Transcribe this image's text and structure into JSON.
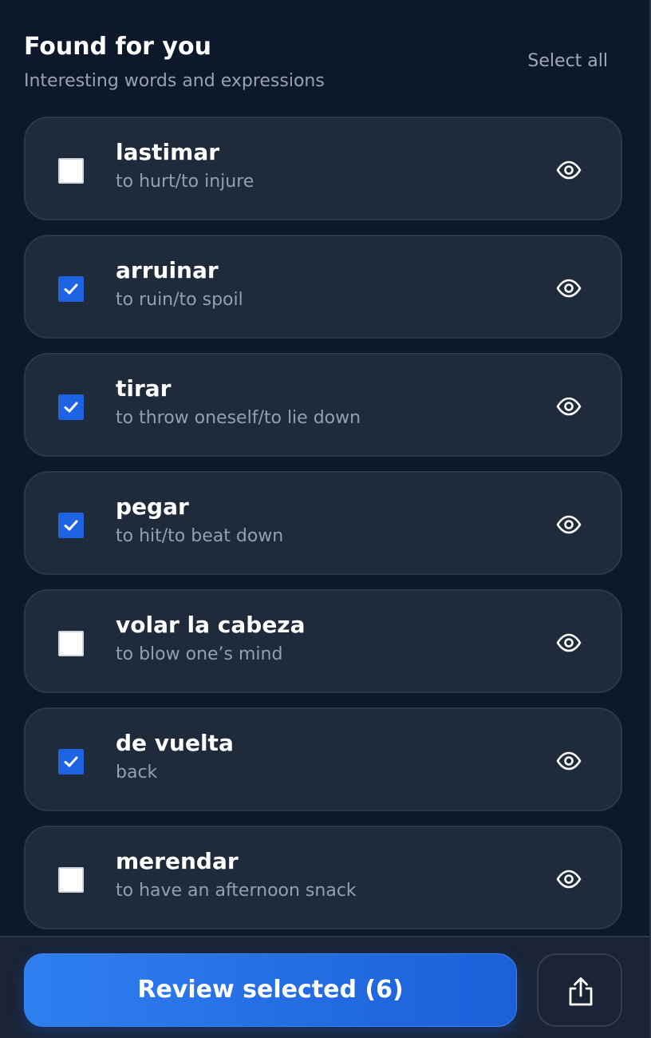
{
  "header": {
    "title": "Found for you",
    "subtitle": "Interesting words and expressions",
    "select_all_label": "Select all"
  },
  "items": [
    {
      "word": "lastimar",
      "translation": "to hurt/to injure",
      "checked": false
    },
    {
      "word": "arruinar",
      "translation": "to ruin/to spoil",
      "checked": true
    },
    {
      "word": "tirar",
      "translation": "to throw oneself/to lie down",
      "checked": true
    },
    {
      "word": "pegar",
      "translation": "to hit/to beat down",
      "checked": true
    },
    {
      "word": "volar la cabeza",
      "translation": "to blow one’s mind",
      "checked": false
    },
    {
      "word": "de vuelta",
      "translation": "back",
      "checked": true
    },
    {
      "word": "merendar",
      "translation": "to have an afternoon snack",
      "checked": false
    }
  ],
  "footer": {
    "review_button_label": "Review selected (6)",
    "share_icon": "share-icon"
  },
  "colors": {
    "background": "#0e182b",
    "card": "#1f2a3b",
    "accent": "#1d63e3",
    "muted_text": "#94a0b2"
  }
}
